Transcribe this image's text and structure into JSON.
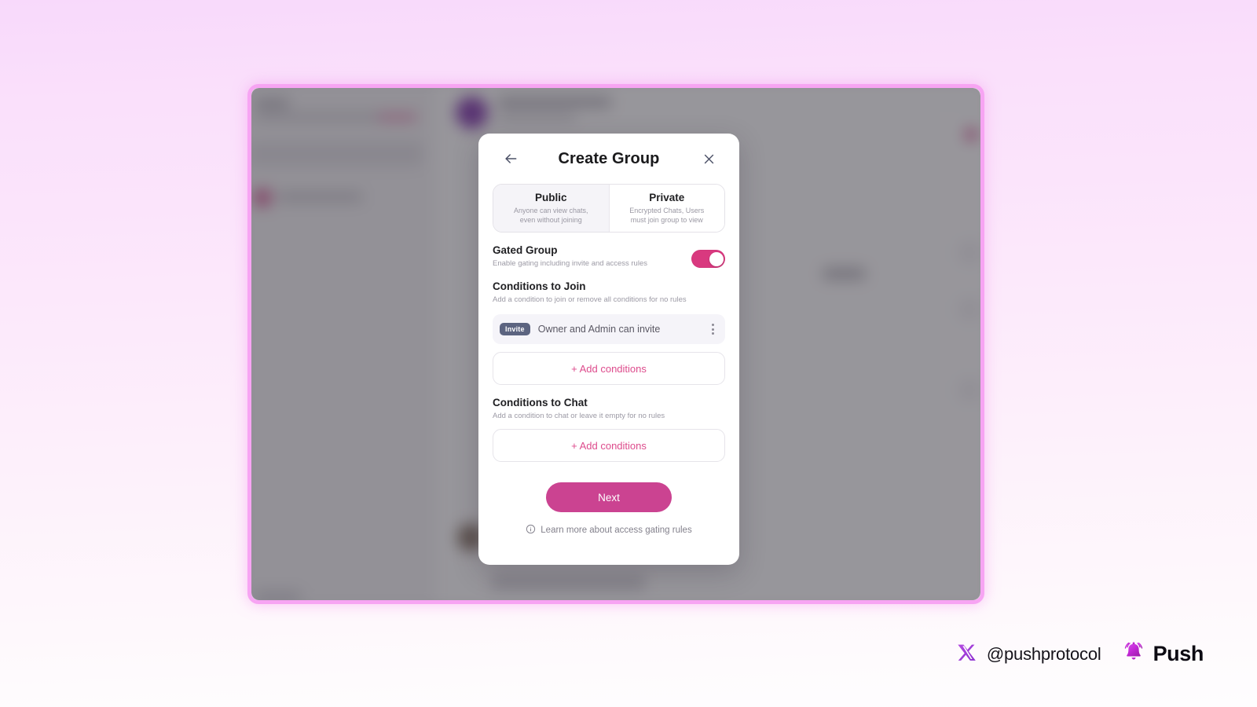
{
  "app": {
    "window_label": "push-chat-app-window"
  },
  "modal": {
    "title": "Create Group",
    "back_icon": "arrow-left-icon",
    "close_icon": "close-icon",
    "visibility": {
      "selected": "Public",
      "options": [
        {
          "name": "Public",
          "description_line1": "Anyone can view chats,",
          "description_line2": "even without joining",
          "selected": true
        },
        {
          "name": "Private",
          "description_line1": "Encrypted Chats, Users",
          "description_line2": "must join group to view",
          "selected": false
        }
      ]
    },
    "gated_group": {
      "title": "Gated Group",
      "subtitle": "Enable gating including invite and access rules",
      "toggle_on": true,
      "toggle_color": "#d9397f"
    },
    "conditions_to_join": {
      "title": "Conditions to Join",
      "subtitle": "Add a condition to join or remove all conditions for no rules",
      "conditions": [
        {
          "badge": "Invite",
          "badge_color": "#5c6480",
          "text": "Owner and Admin can invite",
          "menu_icon": "kebab-menu-icon"
        }
      ],
      "add_label": "+ Add conditions"
    },
    "conditions_to_chat": {
      "title": "Conditions to Chat",
      "subtitle": "Add a condition to chat or leave it empty for no rules",
      "conditions": [],
      "add_label": "+ Add conditions"
    },
    "next_label": "Next",
    "next_color": "#cb4391",
    "learn_more": {
      "icon": "info-icon",
      "label": "Learn more about access gating rules"
    }
  },
  "branding": {
    "x_icon": "x-twitter-icon",
    "x_handle": "@pushprotocol",
    "bell_icon": "push-bell-icon",
    "product": "Push"
  },
  "theme": {
    "page_gradient_top": "#f8d9fb",
    "page_gradient_bottom": "#fefdfe",
    "window_border": "#f7a4f3",
    "accent_pink": "#dd4b8c"
  }
}
